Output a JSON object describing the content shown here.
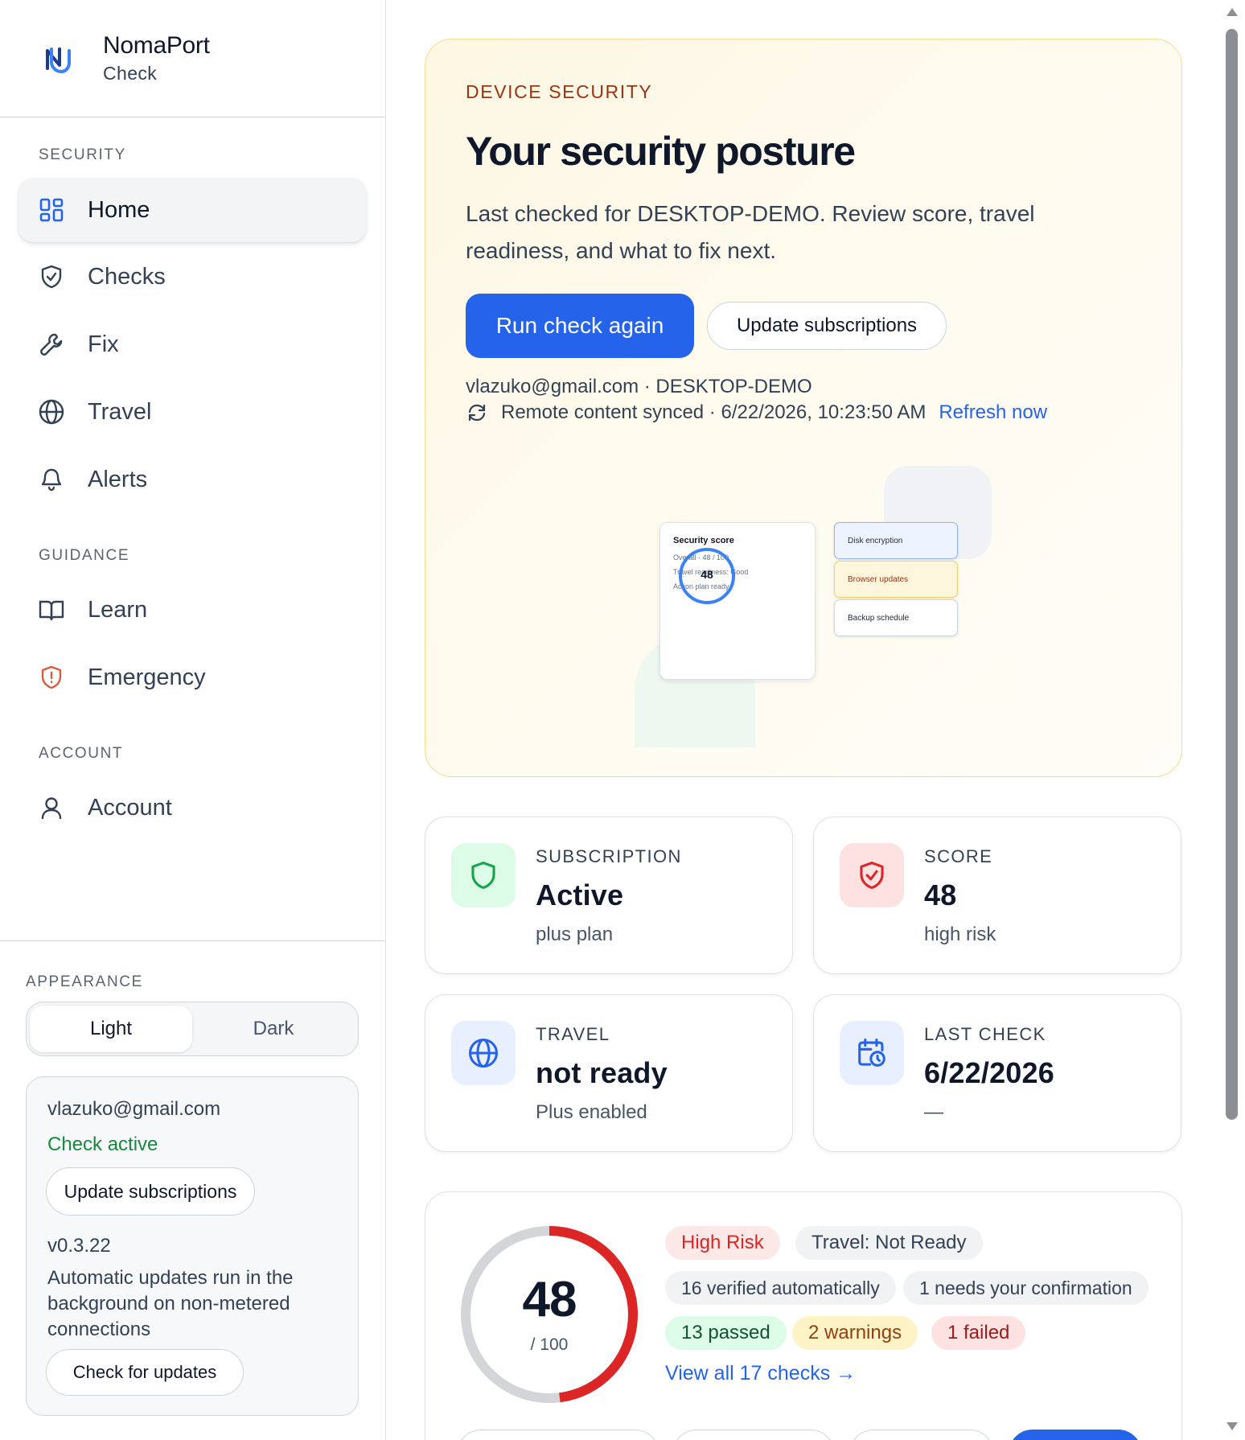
{
  "brand": {
    "name": "NomaPort",
    "subtitle": "Check"
  },
  "sidebar": {
    "sections": {
      "security": "SECURITY",
      "guidance": "GUIDANCE",
      "account": "ACCOUNT"
    },
    "items": [
      {
        "label": "Home",
        "icon": "grid-icon",
        "active": true
      },
      {
        "label": "Checks",
        "icon": "shield-check-icon"
      },
      {
        "label": "Fix",
        "icon": "wrench-icon"
      },
      {
        "label": "Travel",
        "icon": "globe-icon"
      },
      {
        "label": "Alerts",
        "icon": "bell-icon"
      },
      {
        "label": "Learn",
        "icon": "book-open-icon"
      },
      {
        "label": "Emergency",
        "icon": "shield-alert-icon"
      },
      {
        "label": "Account",
        "icon": "user-icon"
      }
    ],
    "appearance": {
      "label": "APPEARANCE",
      "options": [
        "Light",
        "Dark"
      ],
      "selected": "Light"
    },
    "account_card": {
      "email": "vlazuko@gmail.com",
      "status": "Check active",
      "update_button": "Update subscriptions",
      "version": "v0.3.22",
      "note": "Automatic updates run in the background on non-metered connections",
      "check_updates_button": "Check for updates"
    }
  },
  "hero": {
    "eyebrow": "DEVICE SECURITY",
    "title": "Your security posture",
    "description": "Last checked for DESKTOP-DEMO. Review score, travel readiness, and what to fix next.",
    "primary_button": "Run check again",
    "secondary_button": "Update subscriptions",
    "meta": "vlazuko@gmail.com · DESKTOP-DEMO",
    "sync_text": "Remote content synced · 6/22/2026, 10:23:50 AM",
    "refresh_link": "Refresh now",
    "illustration": {
      "card_title": "Security score",
      "line1": "Overall · 48 / 100",
      "line2": "Travel readiness: Good",
      "line3": "Action plan ready",
      "score": "48",
      "mini_cards": [
        "Disk encryption",
        "Browser updates",
        "Backup schedule"
      ]
    }
  },
  "stats": [
    {
      "label": "SUBSCRIPTION",
      "value": "Active",
      "sub": "plus plan",
      "icon": "shield-icon",
      "color": "#16a34a"
    },
    {
      "label": "SCORE",
      "value": "48",
      "sub": "high risk",
      "icon": "shield-check-icon",
      "color": "#dc2626"
    },
    {
      "label": "TRAVEL",
      "value": "not ready",
      "sub": "Plus enabled",
      "icon": "globe-icon",
      "color": "#2563eb"
    },
    {
      "label": "LAST CHECK",
      "value": "6/22/2026",
      "sub": "—",
      "icon": "calendar-clock-icon",
      "color": "#2563eb"
    }
  ],
  "score_panel": {
    "score": "48",
    "denominator": "/ 100",
    "score_fraction": 0.48,
    "chips": {
      "risk": "High Risk",
      "travel": "Travel: Not Ready",
      "verified": "16 verified automatically",
      "confirm": "1 needs your confirmation",
      "passed": "13 passed",
      "warnings": "2 warnings",
      "failed": "1 failed"
    },
    "view_link": "View all 17 checks →"
  },
  "colors": {
    "accent": "#2563eb",
    "danger": "#dc2626",
    "success": "#16893e",
    "warning_bg": "#fef3c7"
  }
}
